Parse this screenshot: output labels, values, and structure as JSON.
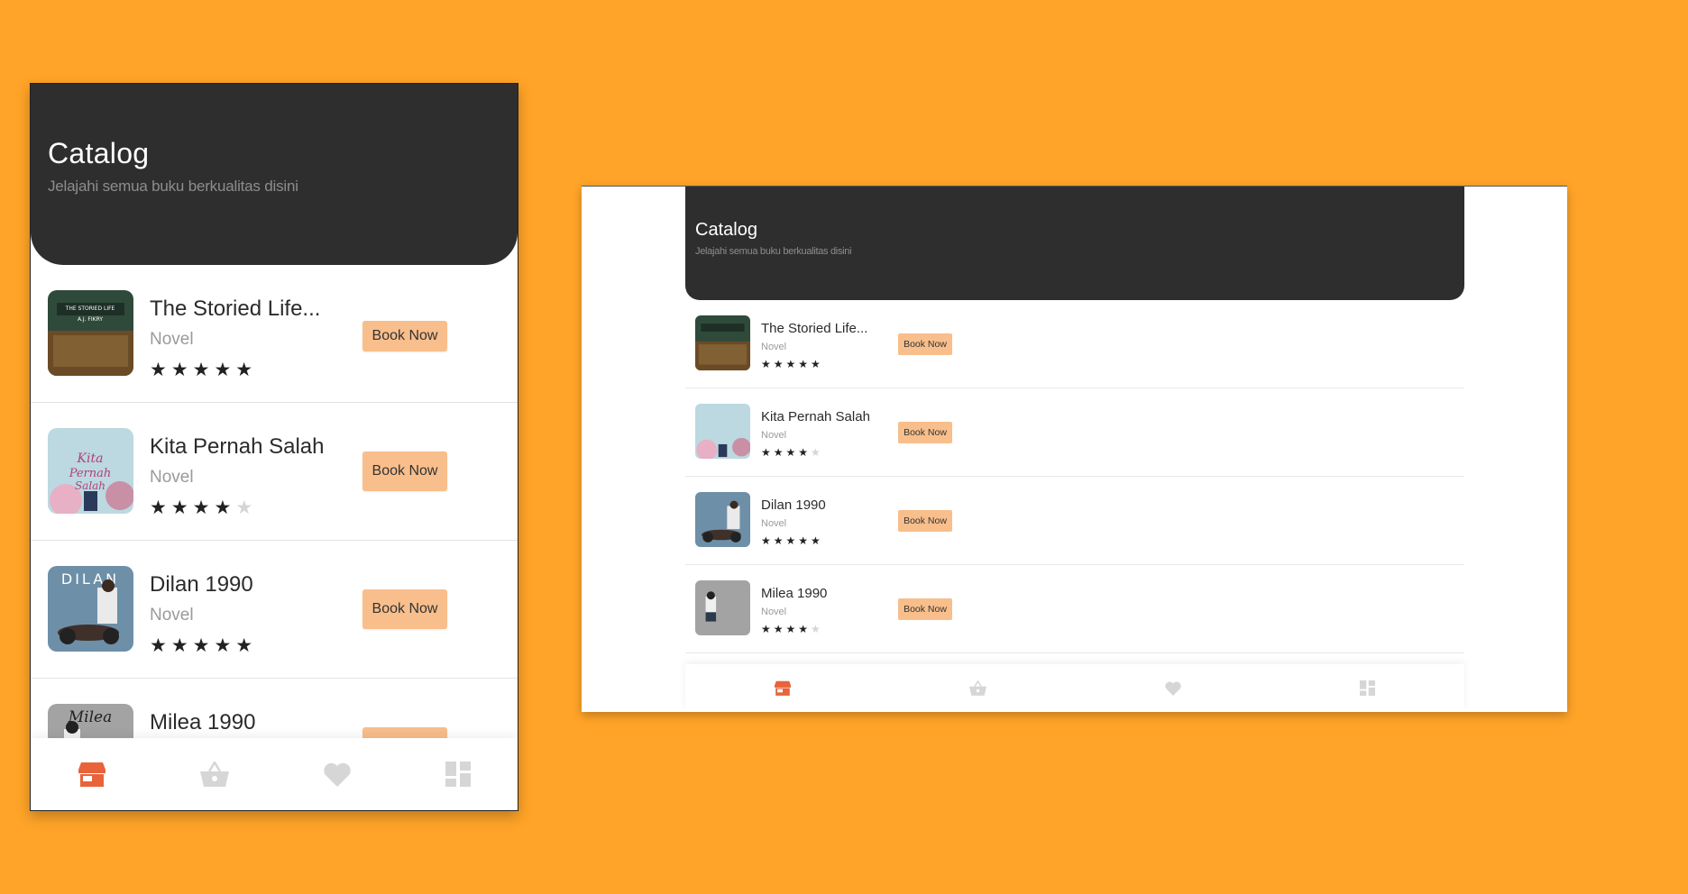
{
  "catalog": {
    "title": "Catalog",
    "subtitle": "Jelajahi semua buku berkualitas disini"
  },
  "books": [
    {
      "title": "The Storied Life...",
      "genre": "Novel",
      "rating": 5,
      "button": "Book Now",
      "cover_colors": [
        "#2f4a3a",
        "#7a5a2e"
      ]
    },
    {
      "title": "Kita Pernah Salah",
      "genre": "Novel",
      "rating": 4,
      "button": "Book Now",
      "cover_colors": [
        "#b9d4dd",
        "#e7b0c4"
      ]
    },
    {
      "title": "Dilan 1990",
      "genre": "Novel",
      "rating": 5,
      "button": "Book Now",
      "cover_colors": [
        "#6d8fa8",
        "#4a3b34"
      ]
    },
    {
      "title": "Milea 1990",
      "genre": "Novel",
      "rating": 4,
      "button": "Book Now",
      "cover_colors": [
        "#9c9c9c",
        "#d9d9d9"
      ]
    }
  ],
  "nav": {
    "items": [
      {
        "icon": "store-icon",
        "active": true
      },
      {
        "icon": "basket-icon",
        "active": false
      },
      {
        "icon": "heart-icon",
        "active": false
      },
      {
        "icon": "dashboard-icon",
        "active": false
      }
    ],
    "active_color": "#E8633A",
    "inactive_color": "#D6D6D6"
  },
  "colors": {
    "background": "#FFA428",
    "header": "#2E2E2E",
    "button": "#F8BE8B"
  }
}
